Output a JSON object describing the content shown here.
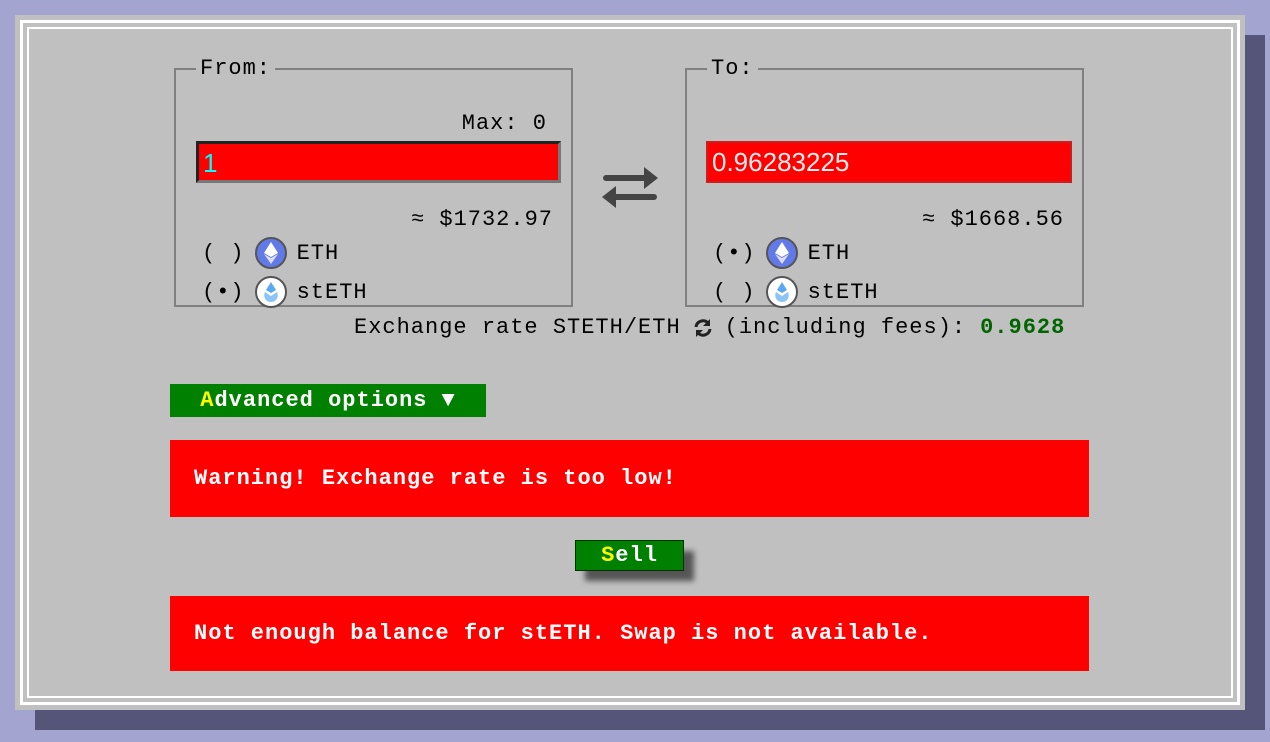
{
  "from": {
    "legend": "From:",
    "max_label": "Max:",
    "max_value": "0",
    "amount": "1",
    "usd": "≈ $1732.97",
    "options": [
      {
        "mark": "( )",
        "label": "ETH",
        "icon": "eth-icon",
        "selected": false
      },
      {
        "mark": "(•)",
        "label": "stETH",
        "icon": "steth-icon",
        "selected": true
      }
    ]
  },
  "to": {
    "legend": "To:",
    "amount": "0.96283225",
    "usd": "≈ $1668.56",
    "options": [
      {
        "mark": "(•)",
        "label": "ETH",
        "icon": "eth-icon",
        "selected": true
      },
      {
        "mark": "( )",
        "label": "stETH",
        "icon": "steth-icon",
        "selected": false
      }
    ]
  },
  "exchange": {
    "prefix": "Exchange rate STETH/ETH",
    "suffix": "(including fees):",
    "value": "0.9628",
    "value_color": "#006400"
  },
  "advanced": {
    "hotkey": "A",
    "rest": "dvanced options",
    "arrow": "▼"
  },
  "warning": "Warning! Exchange rate is too low!",
  "sell": {
    "hotkey": "S",
    "rest": "ell"
  },
  "error": "Not enough balance for stETH. Swap is not available."
}
